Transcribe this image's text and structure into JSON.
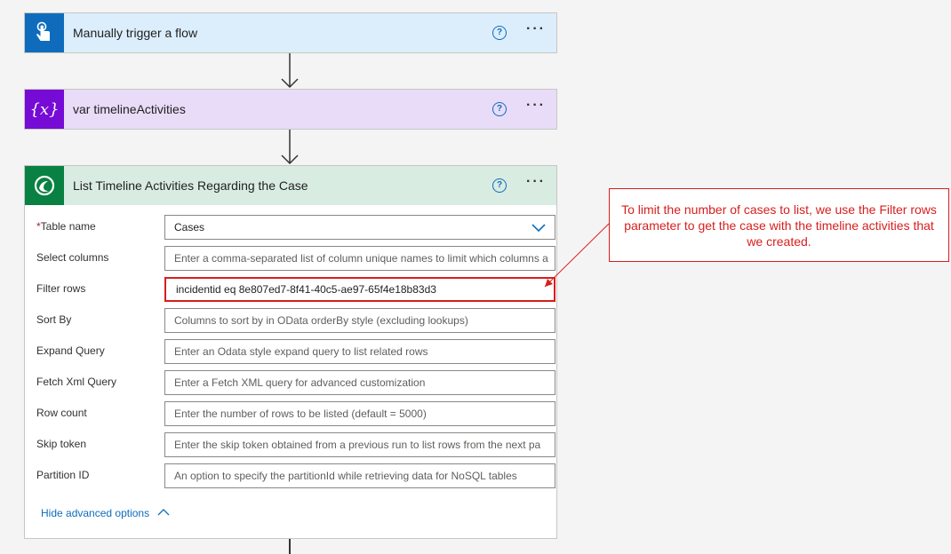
{
  "steps": [
    {
      "title": "Manually trigger a flow",
      "icon": "touch-icon",
      "color": "#0f6cbd",
      "bg": "#dceefc"
    },
    {
      "title": "var timelineActivities",
      "icon": "variable-icon",
      "color": "#770bd6",
      "bg": "#e9dcf8"
    },
    {
      "title": "List Timeline Activities Regarding the Case",
      "icon": "dataverse-icon",
      "color": "#088142",
      "bg": "#d9ece2"
    }
  ],
  "help_label": "?",
  "more_label": "···",
  "form": {
    "required_marker": "*",
    "fields": [
      {
        "label": "Table name",
        "value": "Cases",
        "kind": "select"
      },
      {
        "label": "Select columns",
        "placeholder": "Enter a comma-separated list of column unique names to limit which columns a"
      },
      {
        "label": "Filter rows",
        "value": "incidentid eq 8e807ed7-8f41-40c5-ae97-65f4e18b83d3"
      },
      {
        "label": "Sort By",
        "placeholder": "Columns to sort by in OData orderBy style (excluding lookups)"
      },
      {
        "label": "Expand Query",
        "placeholder": "Enter an Odata style expand query to list related rows"
      },
      {
        "label": "Fetch Xml Query",
        "placeholder": "Enter a Fetch XML query for advanced customization"
      },
      {
        "label": "Row count",
        "placeholder": "Enter the number of rows to be listed (default = 5000)"
      },
      {
        "label": "Skip token",
        "placeholder": "Enter the skip token obtained from a previous run to list rows from the next pa"
      },
      {
        "label": "Partition ID",
        "placeholder": "An option to specify the partitionId while retrieving data for NoSQL tables"
      }
    ],
    "hide_advanced_label": "Hide advanced options"
  },
  "callout": {
    "text": "To limit the number of cases to list, we use the Filter rows parameter to get the case with the timeline activities that we created.",
    "color": "#d81e1e"
  }
}
